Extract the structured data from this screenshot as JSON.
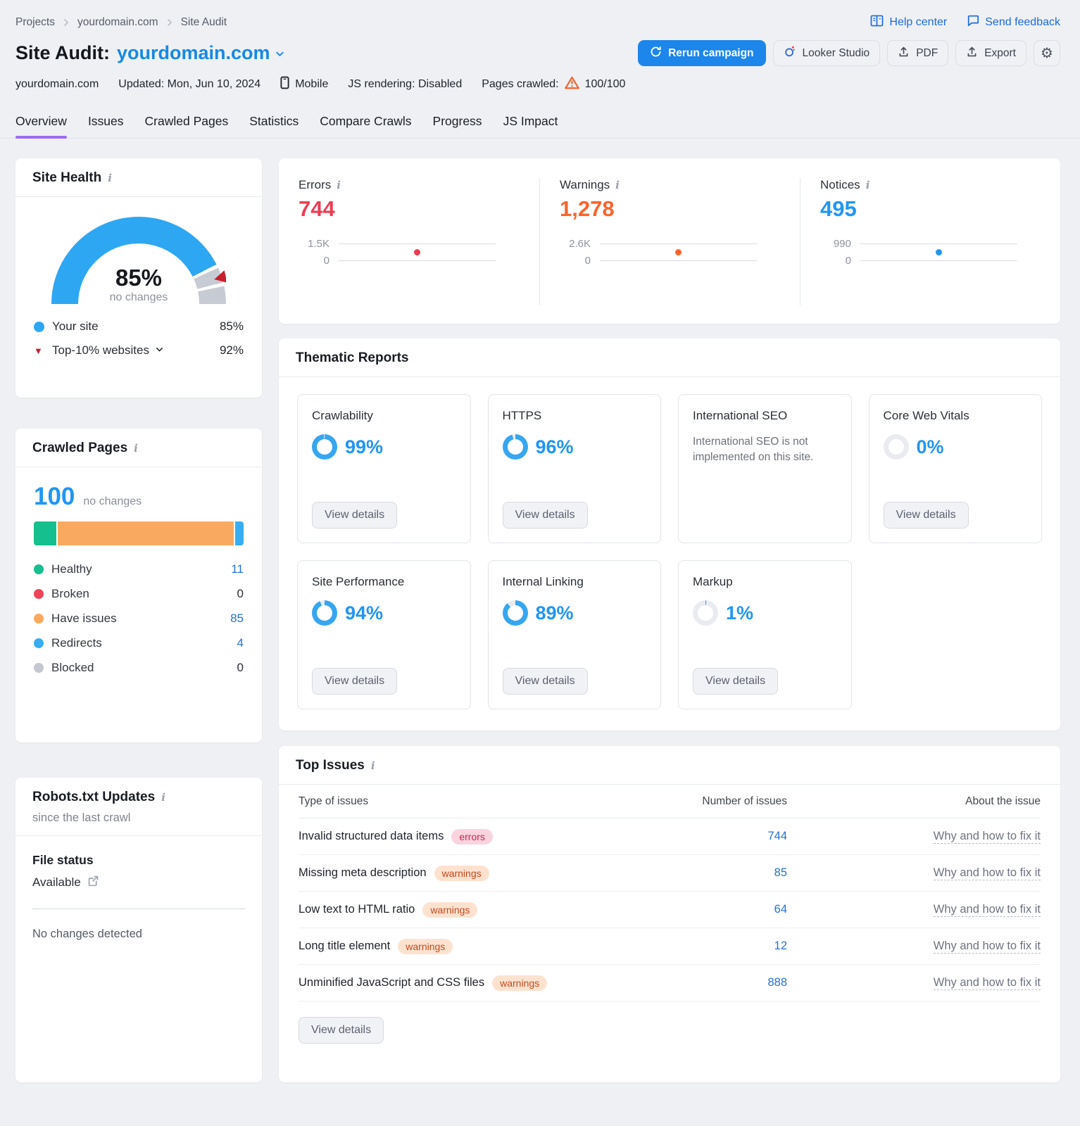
{
  "breadcrumb": {
    "items": [
      "Projects",
      "yourdomain.com",
      "Site Audit"
    ]
  },
  "top_links": {
    "help_center": "Help center",
    "send_feedback": "Send feedback"
  },
  "header": {
    "title": "Site Audit:",
    "domain": "yourdomain.com",
    "rerun_button": "Rerun campaign",
    "looker_button": "Looker Studio",
    "pdf_button": "PDF",
    "export_button": "Export"
  },
  "meta": {
    "domain": "yourdomain.com",
    "updated": "Updated: Mon, Jun 10, 2024",
    "device": "Mobile",
    "js_rendering": "JS rendering: Disabled",
    "pages_crawled_label": "Pages crawled:",
    "pages_crawled_value": "100/100"
  },
  "tabs": [
    {
      "label": "Overview",
      "active": true
    },
    {
      "label": "Issues",
      "active": false
    },
    {
      "label": "Crawled Pages",
      "active": false
    },
    {
      "label": "Statistics",
      "active": false
    },
    {
      "label": "Compare Crawls",
      "active": false
    },
    {
      "label": "Progress",
      "active": false
    },
    {
      "label": "JS Impact",
      "active": false
    }
  ],
  "site_health": {
    "title": "Site Health",
    "score_pct": 85,
    "score_label": "85%",
    "score_sub": "no changes",
    "benchmark_pct": 92,
    "legend": [
      {
        "label": "Your site",
        "value": "85%"
      },
      {
        "label": "Top-10% websites",
        "value": "92%"
      }
    ],
    "colors": {
      "arc_blue": "#2ea7f2",
      "arc_gray": "#c7cbd4",
      "pointer_red": "#c71f2d"
    }
  },
  "stats": {
    "items": [
      {
        "label": "Errors",
        "value": "744",
        "value_num": 744,
        "max_label": "1.5K",
        "max_num": 1500,
        "min_label": "0",
        "color": "#ee3d54"
      },
      {
        "label": "Warnings",
        "value": "1,278",
        "value_num": 1278,
        "max_label": "2.6K",
        "max_num": 2600,
        "min_label": "0",
        "color": "#fc642d"
      },
      {
        "label": "Notices",
        "value": "495",
        "value_num": 495,
        "max_label": "990",
        "max_num": 990,
        "min_label": "0",
        "color": "#2196f3"
      }
    ]
  },
  "thematic": {
    "title": "Thematic Reports",
    "view_details": "View details",
    "donut_blue": "#36a6f1",
    "donut_gray": "#e9ebf0",
    "cards": [
      {
        "name": "Crawlability",
        "pct": 99,
        "pct_label": "99%"
      },
      {
        "name": "HTTPS",
        "pct": 96,
        "pct_label": "96%"
      },
      {
        "name": "International SEO",
        "note": "International SEO is not implemented on this site."
      },
      {
        "name": "Core Web Vitals",
        "pct": 0,
        "pct_label": "0%"
      },
      {
        "name": "Site Performance",
        "pct": 94,
        "pct_label": "94%"
      },
      {
        "name": "Internal Linking",
        "pct": 89,
        "pct_label": "89%"
      },
      {
        "name": "Markup",
        "pct": 1,
        "pct_label": "1%"
      }
    ]
  },
  "crawled_pages": {
    "title": "Crawled Pages",
    "total": "100",
    "total_sub": "no changes",
    "segments": [
      {
        "name": "Healthy",
        "value": 11,
        "color": "#16bf8e"
      },
      {
        "name": "Have issues",
        "value": 85,
        "color": "#f9aa60"
      },
      {
        "name": "Redirects",
        "value": 4,
        "color": "#38adf2"
      }
    ],
    "legend": [
      {
        "name": "Healthy",
        "value": "11",
        "color": "#16bf8e",
        "link": true
      },
      {
        "name": "Broken",
        "value": "0",
        "color": "#f0445a",
        "link": false
      },
      {
        "name": "Have issues",
        "value": "85",
        "color": "#f9aa60",
        "link": true
      },
      {
        "name": "Redirects",
        "value": "4",
        "color": "#38adf2",
        "link": true
      },
      {
        "name": "Blocked",
        "value": "0",
        "color": "#c4c7d0",
        "link": false
      }
    ]
  },
  "robots": {
    "title": "Robots.txt Updates",
    "subtitle": "since the last crawl",
    "file_status_label": "File status",
    "file_status_value": "Available",
    "no_changes": "No changes detected"
  },
  "top_issues": {
    "title": "Top Issues",
    "columns": [
      "Type of issues",
      "Number of issues",
      "About the issue"
    ],
    "link_label": "Why and how to fix it",
    "view_details": "View details",
    "rows": [
      {
        "name": "Invalid structured data items",
        "badge": "errors",
        "count": "744"
      },
      {
        "name": "Missing meta description",
        "badge": "warnings",
        "count": "85"
      },
      {
        "name": "Low text to HTML ratio",
        "badge": "warnings",
        "count": "64"
      },
      {
        "name": "Long title element",
        "badge": "warnings",
        "count": "12"
      },
      {
        "name": "Unminified JavaScript and CSS files",
        "badge": "warnings",
        "count": "888"
      }
    ]
  }
}
